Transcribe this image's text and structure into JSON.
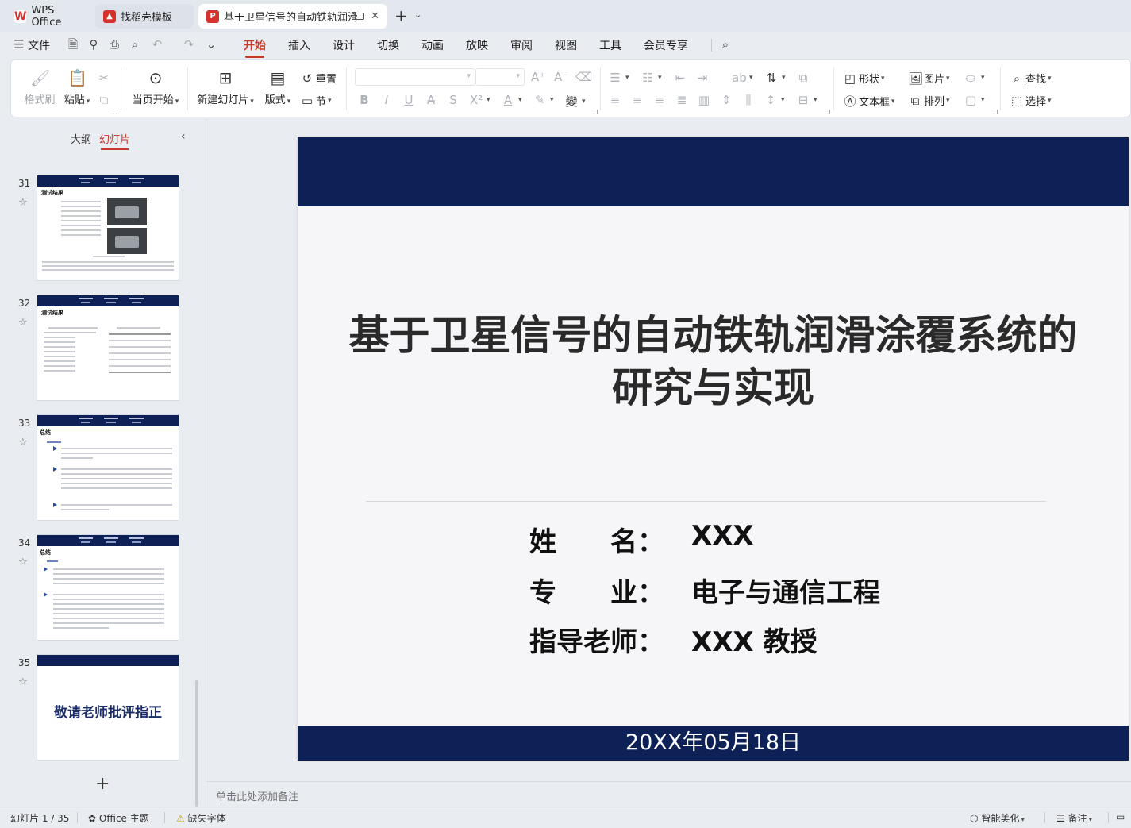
{
  "tabs": [
    {
      "label": "WPS Office",
      "icon": "wps-logo-icon"
    },
    {
      "label": "找稻壳模板",
      "icon": "docer-icon"
    },
    {
      "label": "基于卫星信号的自动铁轨润滑涂",
      "icon": "ppt-file-icon",
      "active": true
    }
  ],
  "menu": {
    "file": "文件",
    "items": [
      "开始",
      "插入",
      "设计",
      "切换",
      "动画",
      "放映",
      "审阅",
      "视图",
      "工具",
      "会员专享"
    ],
    "active": "开始"
  },
  "ribbon": {
    "format_painter": "格式刷",
    "paste": "粘贴",
    "play_from_current": "当页开始",
    "new_slide": "新建幻灯片",
    "layout": "版式",
    "section": "节",
    "reset": "重置",
    "shape": "形状",
    "picture": "图片",
    "find": "查找",
    "textbox": "文本框",
    "arrange": "排列",
    "select": "选择"
  },
  "panel": {
    "tab_outline": "大纲",
    "tab_slides": "幻灯片",
    "slides": [
      {
        "num": "31",
        "title": "测试结果"
      },
      {
        "num": "32",
        "title": "测试结果"
      },
      {
        "num": "33",
        "title": "总结"
      },
      {
        "num": "34",
        "title": "总结"
      },
      {
        "num": "35",
        "title": "敬请老师批评指正"
      }
    ]
  },
  "slide": {
    "title_line1": "基于卫星信号的自动铁轨润滑涂覆系统的",
    "title_line2": "研究与实现",
    "rows": [
      {
        "label": "姓　　名：",
        "value": "XXX"
      },
      {
        "label": "专　　业：",
        "value": "电子与通信工程"
      },
      {
        "label": "指导老师：",
        "value": "XXX 教授"
      }
    ],
    "date": "20XX年05月18日"
  },
  "notes_placeholder": "单击此处添加备注",
  "status": {
    "slide_counter": "幻灯片 1 / 35",
    "theme": "Office 主题",
    "missing_font": "缺失字体",
    "smart_beautify": "智能美化",
    "notes": "备注"
  },
  "colors": {
    "accent": "#c8392b",
    "slide_navy": "#0d2157"
  }
}
